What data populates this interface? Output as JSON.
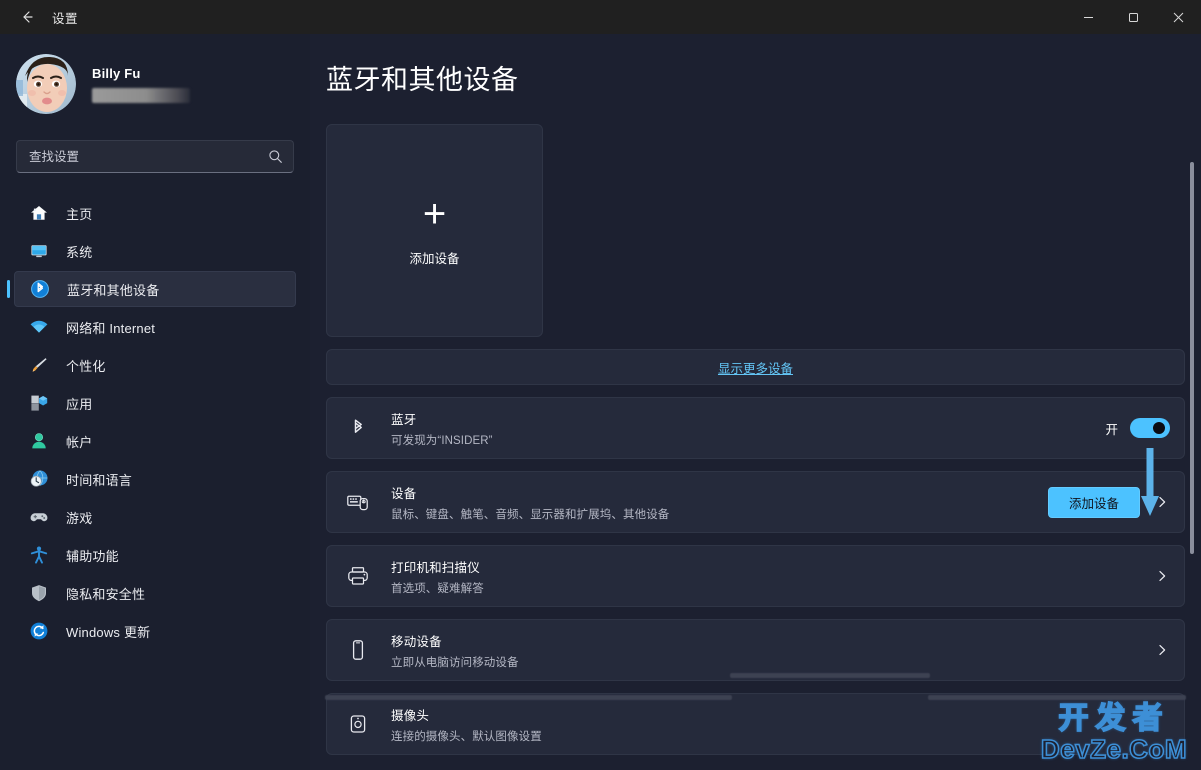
{
  "window": {
    "title": "设置",
    "back_icon": "back-arrow-icon",
    "controls": {
      "minimize": "minimize-icon",
      "maximize": "restore-icon",
      "close": "close-icon"
    }
  },
  "sidebar": {
    "profile": {
      "name": "Billy Fu",
      "email_redacted": true,
      "avatar": "user-avatar"
    },
    "search": {
      "placeholder": "查找设置",
      "value": "",
      "icon": "search-icon"
    },
    "items": [
      {
        "label": "主页",
        "icon": "home-icon",
        "active": false
      },
      {
        "label": "系统",
        "icon": "system-icon",
        "active": false
      },
      {
        "label": "蓝牙和其他设备",
        "icon": "bluetooth-icon",
        "active": true
      },
      {
        "label": "网络和 Internet",
        "icon": "network-icon",
        "active": false
      },
      {
        "label": "个性化",
        "icon": "brush-icon",
        "active": false
      },
      {
        "label": "应用",
        "icon": "apps-icon",
        "active": false
      },
      {
        "label": "帐户",
        "icon": "account-icon",
        "active": false
      },
      {
        "label": "时间和语言",
        "icon": "time-icon",
        "active": false
      },
      {
        "label": "游戏",
        "icon": "gaming-icon",
        "active": false
      },
      {
        "label": "辅助功能",
        "icon": "accessibility-icon",
        "active": false
      },
      {
        "label": "隐私和安全性",
        "icon": "shield-icon",
        "active": false
      },
      {
        "label": "Windows 更新",
        "icon": "update-icon",
        "active": false
      }
    ]
  },
  "main": {
    "page_title": "蓝牙和其他设备",
    "add_device_card": {
      "label": "添加设备",
      "icon": "plus-icon"
    },
    "show_more_link": "显示更多设备",
    "rows": [
      {
        "title": "蓝牙",
        "subtitle": "可发现为“INSIDER”",
        "icon": "bluetooth-icon",
        "control": "toggle",
        "toggle_label": "开",
        "toggle_on": true
      },
      {
        "title": "设备",
        "subtitle": "鼠标、键盘、触笔、音频、显示器和扩展坞、其他设备",
        "icon": "devices-icon",
        "control": "button-chevron",
        "button_label": "添加设备",
        "chevron": "chevron-right-icon"
      },
      {
        "title": "打印机和扫描仪",
        "subtitle": "首选项、疑难解答",
        "icon": "printer-icon",
        "control": "chevron",
        "chevron": "chevron-right-icon"
      },
      {
        "title": "移动设备",
        "subtitle": "立即从电脑访问移动设备",
        "icon": "phone-icon",
        "control": "chevron",
        "chevron": "chevron-right-icon"
      },
      {
        "title": "摄像头",
        "subtitle": "连接的摄像头、默认图像设置",
        "icon": "camera-icon",
        "control": "none"
      }
    ]
  },
  "annotation": {
    "arrow": "down-arrow-annotation",
    "color": "#5cb3ea"
  },
  "watermark": {
    "line1": "开发者",
    "line2": "DevZe.CoM",
    "color": "#3d8fd6"
  },
  "colors": {
    "accent": "#4cc2ff",
    "sidebar_bg": "#1b1f2e",
    "main_bg": "#1c2030",
    "card_bg": "#252a3b",
    "titlebar_bg": "#202020",
    "link": "#63c5f5"
  }
}
